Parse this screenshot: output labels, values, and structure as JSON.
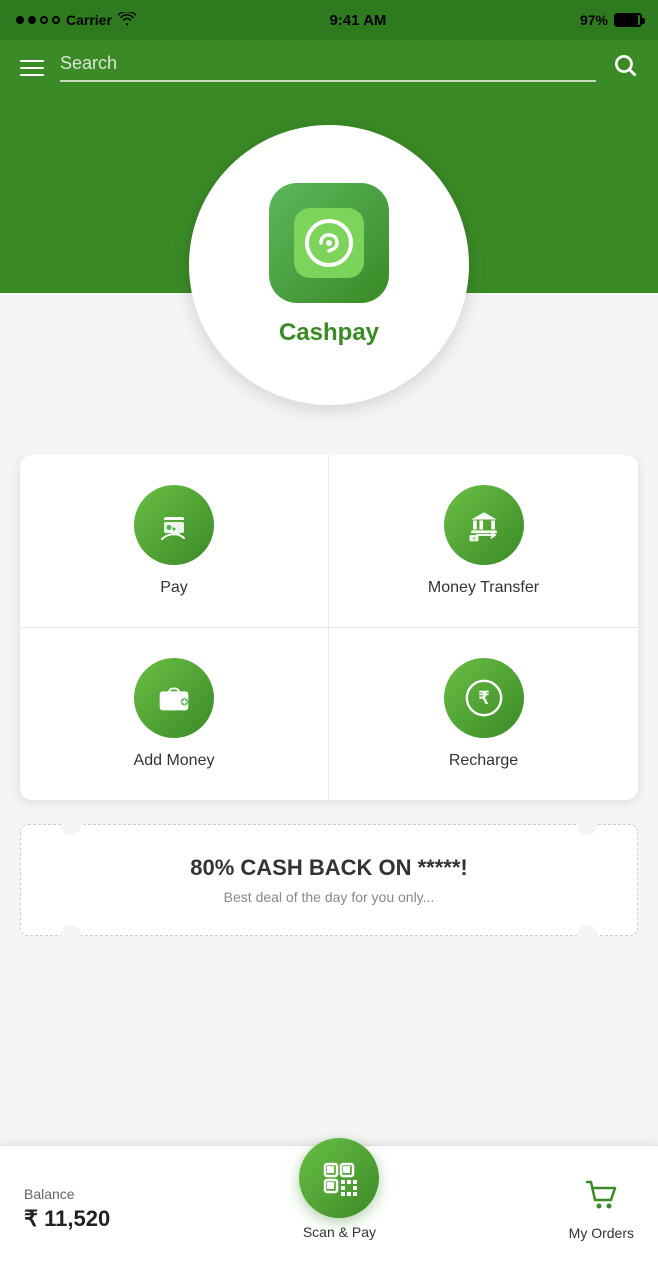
{
  "statusBar": {
    "carrier": "Carrier",
    "time": "9:41 AM",
    "battery": "97%"
  },
  "searchBar": {
    "placeholder": "Search"
  },
  "hero": {
    "appName": "Cashpay"
  },
  "services": [
    {
      "id": "pay",
      "label": "Pay",
      "icon": "pay"
    },
    {
      "id": "money-transfer",
      "label": "Money Transfer",
      "icon": "transfer"
    },
    {
      "id": "add-money",
      "label": "Add Money",
      "icon": "wallet"
    },
    {
      "id": "recharge",
      "label": "Recharge",
      "icon": "rupee"
    }
  ],
  "promo": {
    "title": "80% CASH BACK ON *****!",
    "subtitle": "Best deal of the day for you only..."
  },
  "bottomBar": {
    "balanceLabel": "Balance",
    "balanceAmount": "₹ 11,520",
    "scanLabel": "Scan & Pay",
    "ordersLabel": "My Orders"
  }
}
